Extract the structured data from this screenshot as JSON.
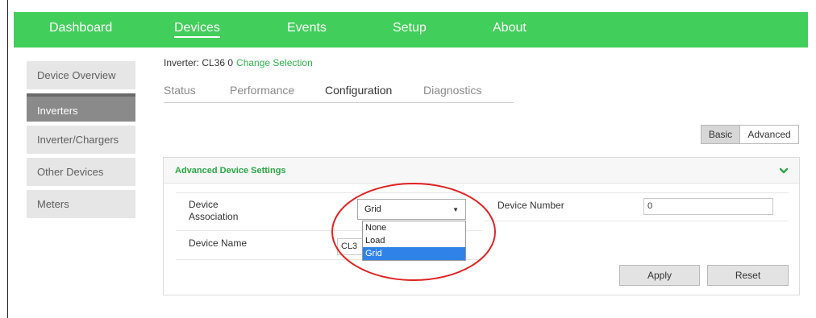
{
  "nav": {
    "items": [
      {
        "label": "Dashboard"
      },
      {
        "label": "Devices"
      },
      {
        "label": "Events"
      },
      {
        "label": "Setup"
      },
      {
        "label": "About"
      }
    ],
    "active": "Devices"
  },
  "sidebar": {
    "items": [
      {
        "label": "Device Overview"
      },
      {
        "label": "Inverters"
      },
      {
        "label": "Inverter/Chargers"
      },
      {
        "label": "Other Devices"
      },
      {
        "label": "Meters"
      }
    ],
    "active": "Inverters"
  },
  "selection": {
    "text": "Inverter: CL36 0",
    "link": "Change Selection"
  },
  "tabs": [
    {
      "label": "Status"
    },
    {
      "label": "Performance"
    },
    {
      "label": "Configuration"
    },
    {
      "label": "Diagnostics"
    }
  ],
  "active_tab": "Configuration",
  "mode_toggle": {
    "basic": "Basic",
    "advanced": "Advanced",
    "selected": "Basic"
  },
  "panel": {
    "title": "Advanced Device Settings",
    "device_association_label": "Device Association",
    "device_association_value": "Grid",
    "device_association_options": [
      "None",
      "Load",
      "Grid"
    ],
    "device_number_label": "Device Number",
    "device_number_value": "0",
    "device_name_label": "Device Name",
    "device_name_value": "CL3",
    "apply": "Apply",
    "reset": "Reset"
  },
  "colors": {
    "nav_bg": "#42ce5a",
    "accent_green": "#2eb34a",
    "highlight_blue": "#2f83e8",
    "annotation_red": "#e02020"
  }
}
